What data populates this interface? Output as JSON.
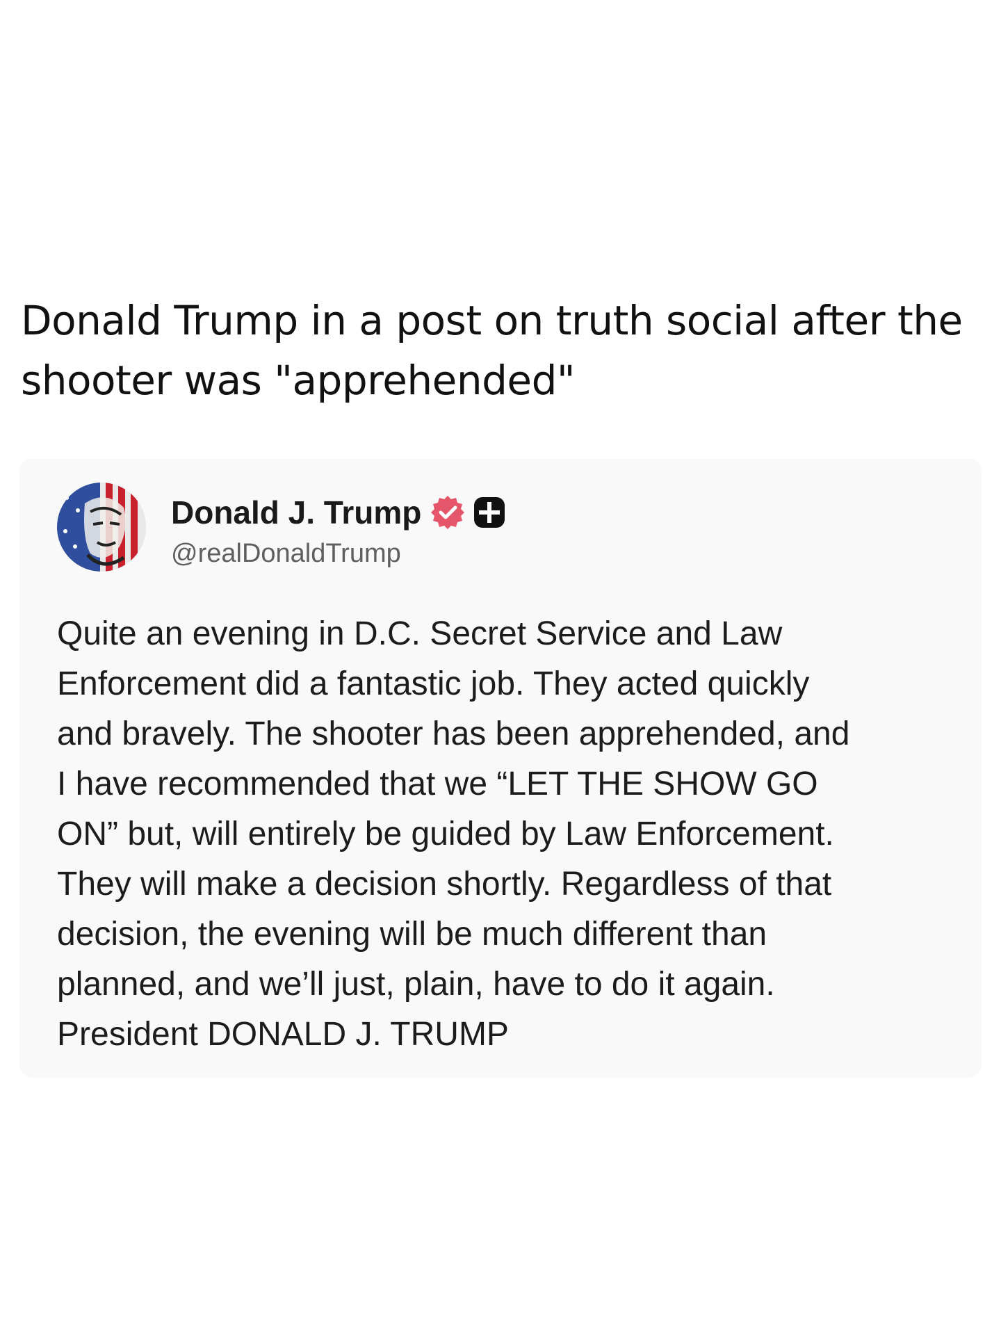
{
  "caption": "Donald Trump in a post on truth social after the shooter was \"apprehended\"",
  "post": {
    "author_name": "Donald J. Trump",
    "author_handle": "@realDonaldTrump",
    "verified_icon": "verified-badge-icon",
    "plus_icon": "plus-badge-icon",
    "accent_color": "#e5566b",
    "body": "Quite an evening in D.C. Secret Service and Law\nEnforcement did a fantastic job. They acted quickly\nand bravely. The shooter has been apprehended, and\nI have recommended that we “LET THE SHOW GO\nON” but, will entirely be guided by Law Enforcement.\nThey will make a decision shortly. Regardless of that\ndecision, the evening will be much different than\nplanned, and we’ll just, plain, have to do it again.\nPresident DONALD J. TRUMP"
  }
}
